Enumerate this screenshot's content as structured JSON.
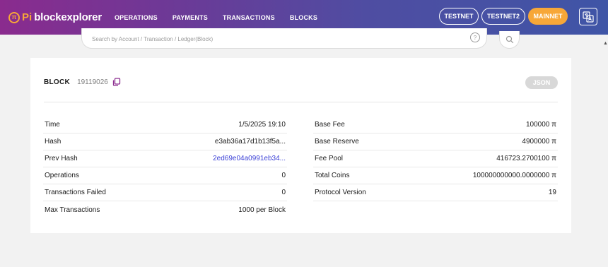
{
  "brand": {
    "logo_glyph": "π",
    "pi": "Pi",
    "name": "blockexplorer"
  },
  "nav": [
    "OPERATIONS",
    "PAYMENTS",
    "TRANSACTIONS",
    "BLOCKS"
  ],
  "networks": [
    {
      "label": "TESTNET",
      "active": false
    },
    {
      "label": "TESTNET2",
      "active": false
    },
    {
      "label": "MAINNET",
      "active": true
    }
  ],
  "translate_icon": "translate-icon",
  "search": {
    "placeholder": "Search by Account / Transaction / Ledger(Block)",
    "help_glyph": "?"
  },
  "block": {
    "label": "BLOCK",
    "number": "19119026",
    "json_button": "JSON"
  },
  "details_left": [
    {
      "label": "Time",
      "value": "1/5/2025 19:10",
      "link": false
    },
    {
      "label": "Hash",
      "value": "e3ab36a17d1b13f5a...",
      "link": false
    },
    {
      "label": "Prev Hash",
      "value": "2ed69e04a0991eb34...",
      "link": true
    },
    {
      "label": "Operations",
      "value": "0",
      "link": false
    },
    {
      "label": "Transactions Failed",
      "value": "0",
      "link": false
    },
    {
      "label": "Max Transactions",
      "value": "1000 per Block",
      "link": false
    }
  ],
  "details_right": [
    {
      "label": "Base Fee",
      "value": "100000 π",
      "link": false
    },
    {
      "label": "Base Reserve",
      "value": "4900000 π",
      "link": false
    },
    {
      "label": "Fee Pool",
      "value": "416723.2700100 π",
      "link": false
    },
    {
      "label": "Total Coins",
      "value": "100000000000.0000000 π",
      "link": false
    },
    {
      "label": "Protocol Version",
      "value": "19",
      "link": false
    }
  ],
  "colors": {
    "accent": "#f7a738",
    "link": "#3a3fd6",
    "gradient_start": "#8a2b8e",
    "gradient_end": "#3f55a6"
  }
}
